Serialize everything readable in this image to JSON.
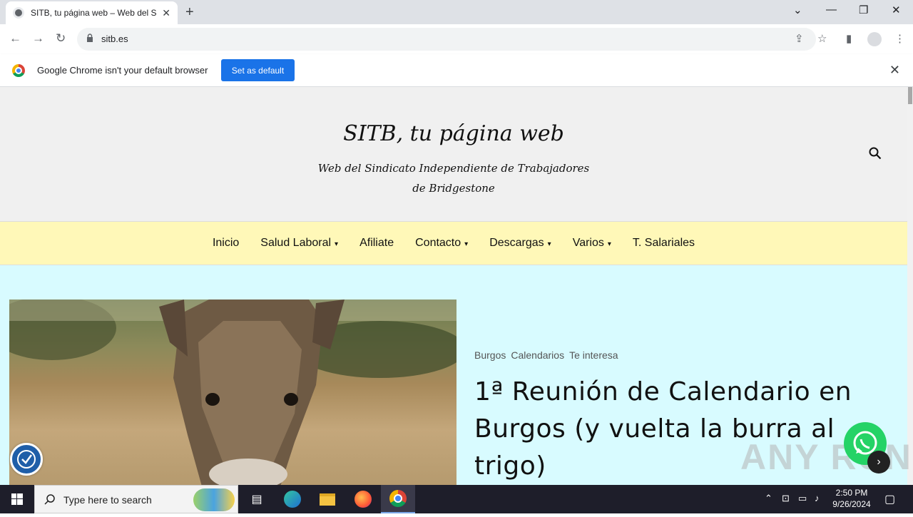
{
  "browser": {
    "tab_title": "SITB, tu página web – Web del Si",
    "url": "sitb.es"
  },
  "infobar": {
    "message": "Google Chrome isn't your default browser",
    "button": "Set as default"
  },
  "site": {
    "title": "SITB, tu página web",
    "description": "Web del Sindicato Independiente de Trabajadores de Bridgestone"
  },
  "menu": {
    "items": [
      {
        "label": "Inicio",
        "dropdown": false
      },
      {
        "label": "Salud Laboral",
        "dropdown": true
      },
      {
        "label": "Afiliate",
        "dropdown": false
      },
      {
        "label": "Contacto",
        "dropdown": true
      },
      {
        "label": "Descargas",
        "dropdown": true
      },
      {
        "label": "Varios",
        "dropdown": true
      },
      {
        "label": "T. Salariales",
        "dropdown": false
      }
    ]
  },
  "post": {
    "categories": [
      "Burgos",
      "Calendarios",
      "Te interesa"
    ],
    "title": "1ª Reunión de Calendario en Burgos (y vuelta la burra al trigo)"
  },
  "watermark": "ANY RUN",
  "taskbar": {
    "search_placeholder": "Type here to search",
    "time": "2:50 PM",
    "date": "9/26/2024"
  },
  "colors": {
    "menubar": "#fff8b8",
    "content_bg": "#d8fbff",
    "header_bg": "#f0f0f0",
    "chrome_blue": "#1a73e8"
  }
}
